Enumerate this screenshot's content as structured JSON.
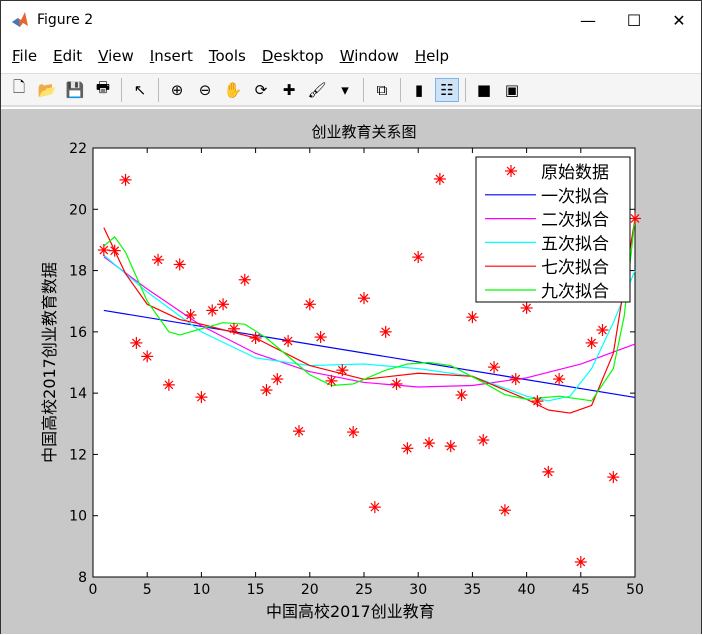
{
  "window": {
    "title": "Figure 2",
    "minimize": "—",
    "maximize": "☐",
    "close": "✕"
  },
  "menu": [
    "File",
    "Edit",
    "View",
    "Insert",
    "Tools",
    "Desktop",
    "Window",
    "Help"
  ],
  "toolbar": [
    {
      "icon": "new-figure-icon",
      "glyph": "🗋"
    },
    {
      "icon": "open-file-icon",
      "glyph": "📂"
    },
    {
      "icon": "save-icon",
      "glyph": "💾"
    },
    {
      "icon": "print-icon",
      "glyph": "🖶"
    },
    {
      "sep": true
    },
    {
      "icon": "pointer-icon",
      "glyph": "↖"
    },
    {
      "sep": true
    },
    {
      "icon": "zoom-in-icon",
      "glyph": "⊕"
    },
    {
      "icon": "zoom-out-icon",
      "glyph": "⊖"
    },
    {
      "icon": "pan-hand-icon",
      "glyph": "✋"
    },
    {
      "icon": "rotate-3d-icon",
      "glyph": "⟳"
    },
    {
      "icon": "data-cursor-icon",
      "glyph": "✚"
    },
    {
      "icon": "brush-icon",
      "glyph": "🖌"
    },
    {
      "icon": "dropdown-arrow-icon",
      "glyph": "▾"
    },
    {
      "sep": true
    },
    {
      "icon": "link-plot-icon",
      "glyph": "⧉"
    },
    {
      "sep": true
    },
    {
      "icon": "colorbar-icon",
      "glyph": "▮"
    },
    {
      "icon": "legend-icon",
      "glyph": "☷",
      "active": true
    },
    {
      "sep": true
    },
    {
      "icon": "hide-plot-tools-icon",
      "glyph": "■"
    },
    {
      "icon": "show-plot-tools-icon",
      "glyph": "▣"
    }
  ],
  "chart_data": {
    "type": "scatter+line",
    "title": "创业教育关系图",
    "xlabel": "中国高校2017创业教育",
    "ylabel": "中国高校2017创业教育数据",
    "xlim": [
      0,
      50
    ],
    "ylim": [
      8,
      22
    ],
    "xticks": [
      0,
      5,
      10,
      15,
      20,
      25,
      30,
      35,
      40,
      45,
      50
    ],
    "yticks": [
      8,
      10,
      12,
      14,
      16,
      18,
      20,
      22
    ],
    "grid": false,
    "legend_position": "top-right",
    "scatter": {
      "name": "原始数据",
      "color": "#ff0000",
      "marker": "*",
      "x": [
        1,
        2,
        3,
        4,
        5,
        6,
        7,
        8,
        9,
        10,
        11,
        12,
        13,
        14,
        15,
        16,
        17,
        18,
        19,
        20,
        21,
        22,
        23,
        24,
        25,
        26,
        27,
        28,
        29,
        30,
        31,
        32,
        33,
        34,
        35,
        36,
        37,
        38,
        39,
        40,
        41,
        42,
        43,
        45,
        46,
        47,
        48,
        50
      ],
      "y": [
        18.67,
        18.65,
        20.96,
        15.64,
        15.2,
        18.35,
        14.27,
        18.2,
        16.55,
        13.87,
        16.7,
        16.9,
        16.1,
        17.7,
        15.8,
        14.1,
        14.46,
        15.7,
        12.76,
        16.9,
        15.83,
        14.4,
        14.75,
        12.73,
        17.1,
        10.28,
        16.0,
        14.3,
        12.2,
        18.44,
        12.37,
        20.99,
        12.27,
        13.94,
        16.48,
        12.47,
        14.85,
        10.18,
        14.46,
        16.78,
        13.74,
        11.43,
        14.46,
        8.49,
        15.64,
        16.06,
        11.26,
        19.7
      ]
    },
    "series": [
      {
        "name": "一次拟合",
        "color": "#0000ff",
        "x": [
          1,
          50
        ],
        "y": [
          16.7,
          13.86
        ]
      },
      {
        "name": "二次拟合",
        "color": "#ff00ff",
        "x": [
          1,
          5,
          10,
          15,
          20,
          25,
          30,
          35,
          40,
          45,
          50
        ],
        "y": [
          18.45,
          17.4,
          16.2,
          15.3,
          14.7,
          14.35,
          14.2,
          14.25,
          14.5,
          14.95,
          15.6
        ]
      },
      {
        "name": "五次拟合",
        "color": "#00ffff",
        "x": [
          1,
          5,
          10,
          15,
          20,
          25,
          30,
          35,
          40,
          42,
          44,
          46,
          48,
          50
        ],
        "y": [
          18.5,
          17.3,
          16.0,
          15.15,
          14.9,
          14.95,
          14.8,
          14.55,
          13.9,
          13.75,
          13.9,
          14.8,
          16.3,
          18.0
        ]
      },
      {
        "name": "七次拟合",
        "color": "#ff0000",
        "x": [
          1,
          3,
          5,
          8,
          10,
          15,
          20,
          25,
          30,
          35,
          40,
          42,
          44,
          46,
          48,
          50
        ],
        "y": [
          19.4,
          17.9,
          16.9,
          16.4,
          16.25,
          15.8,
          14.9,
          14.45,
          14.65,
          14.55,
          13.8,
          13.45,
          13.35,
          13.6,
          15.3,
          19.7
        ]
      },
      {
        "name": "九次拟合",
        "color": "#00ff00",
        "x": [
          1,
          2,
          3,
          5,
          7,
          8,
          10,
          12,
          14,
          16,
          18,
          20,
          22,
          24,
          27,
          29,
          31,
          33,
          36,
          38,
          40,
          43,
          46,
          48,
          49,
          50
        ],
        "y": [
          18.8,
          19.1,
          18.6,
          17.0,
          16.0,
          15.9,
          16.1,
          16.3,
          16.25,
          15.8,
          15.2,
          14.6,
          14.25,
          14.3,
          14.75,
          14.95,
          15.0,
          14.9,
          14.35,
          13.95,
          13.8,
          13.9,
          13.75,
          14.8,
          16.5,
          19.7
        ]
      }
    ]
  }
}
